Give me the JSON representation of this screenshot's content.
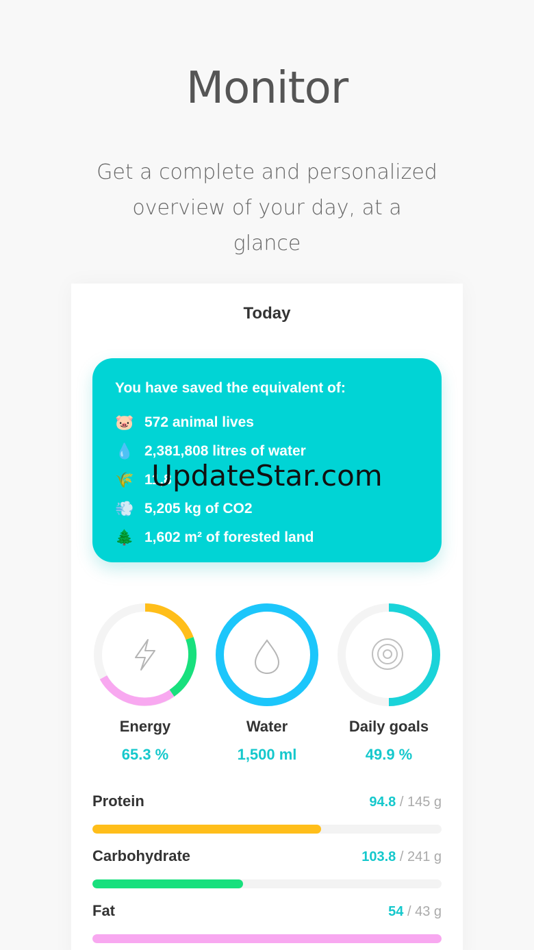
{
  "headline": "Monitor",
  "subtitle_line1": "Get a complete and personalized",
  "subtitle_line2": "overview of your day, at a glance",
  "screen": {
    "title": "Today",
    "savings": {
      "title": "You have saved the equivalent of:",
      "items": [
        {
          "icon": "pig-icon",
          "emoji": "🐷",
          "text": "572 animal lives"
        },
        {
          "icon": "water-drop-icon",
          "emoji": "💧",
          "text": "2,381,808 litres of water"
        },
        {
          "icon": "grain-icon",
          "emoji": "🌾",
          "text": "11,8"
        },
        {
          "icon": "cloud-icon",
          "emoji": "💨",
          "text": "5,205 kg of CO2"
        },
        {
          "icon": "tree-icon",
          "emoji": "🌲",
          "text": "1,602 m² of forested land"
        }
      ]
    },
    "watermark": "UpdateStar.com",
    "rings": [
      {
        "label": "Energy",
        "value": "65.3 %",
        "icon": "lightning-icon"
      },
      {
        "label": "Water",
        "value": "1,500 ml",
        "icon": "drop-icon",
        "fraction": 1.0
      },
      {
        "label": "Daily goals",
        "value": "49.9 %",
        "icon": "target-icon",
        "fraction": 0.499
      }
    ],
    "macros": [
      {
        "name": "Protein",
        "current": "94.8",
        "total": "/ 145 g",
        "fraction": 0.654,
        "color": "#ffbe1a"
      },
      {
        "name": "Carbohydrate",
        "current": "103.8",
        "total": "/ 241 g",
        "fraction": 0.431,
        "color": "#18e07d"
      },
      {
        "name": "Fat",
        "current": "54",
        "total": "/ 43 g",
        "fraction": 1.0,
        "color": "#f8a8f0"
      }
    ]
  },
  "colors": {
    "accent": "#01d4d5",
    "accent_text": "#15c8cc",
    "energy_segments": [
      "#ffbe1a",
      "#18e07d",
      "#f8a8f0"
    ],
    "water": "#1cc6fb",
    "goals": "#1ad3d9",
    "track": "#f4f4f4"
  }
}
